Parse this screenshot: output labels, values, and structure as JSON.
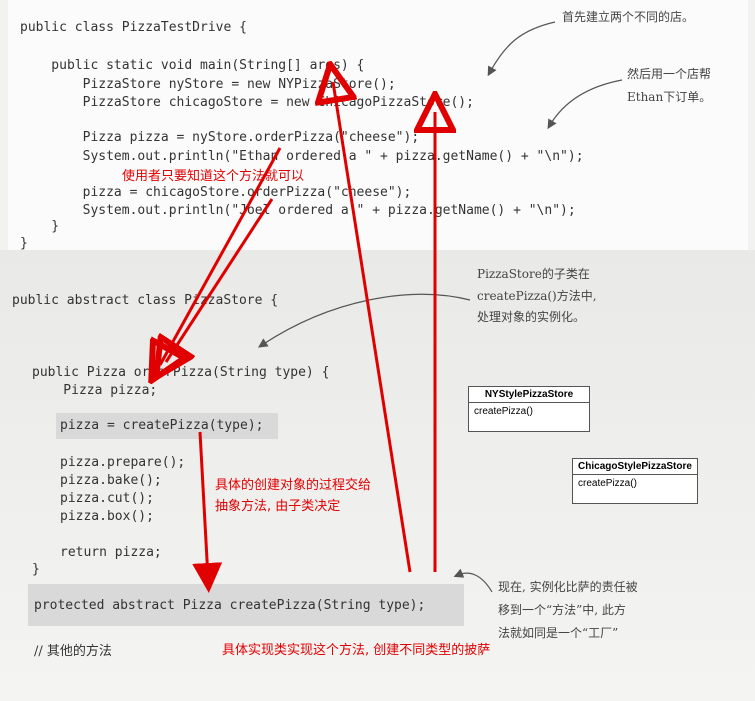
{
  "top_code": {
    "lines": [
      "public class PizzaTestDrive {",
      "    public static void main(String[] args) {",
      "        PizzaStore nyStore = new NYPizzaStore();",
      "        PizzaStore chicagoStore = new ChicagoPizzaStore();",
      "        Pizza pizza = nyStore.orderPizza(\"cheese\");",
      "        System.out.println(\"Ethan ordered a \" + pizza.getName() + \"\\n\");",
      "        pizza = chicagoStore.orderPizza(\"cheese\");",
      "        System.out.println(\"Joel ordered a \" + pizza.getName() + \"\\n\");",
      "    }",
      "}"
    ]
  },
  "bottom_code": {
    "lines": [
      "public abstract class PizzaStore {",
      "public Pizza orderPizza(String type) {",
      "    Pizza pizza;",
      "pizza = createPizza(type);",
      "pizza.prepare();",
      "pizza.bake();",
      "pizza.cut();",
      "pizza.box();",
      "return pizza;",
      "}",
      "protected abstract Pizza createPizza(String type);",
      "// 其他的方法"
    ]
  },
  "annotations": {
    "note1": "首先建立两个不同的店。",
    "note2_line1": "然后用一个店帮",
    "note2_line2": "Ethan下订单。",
    "note3_line1": "PizzaStore的子类在",
    "note3_line2": "createPizza()方法中,",
    "note3_line3": "处理对象的实例化。",
    "note4_line1": "现在, 实例化比萨的责任被",
    "note4_line2": "移到一个“方法”中, 此方",
    "note4_line3": "法就如同是一个“工厂”"
  },
  "red_notes": {
    "user_only": "使用者只要知道这个方法就可以",
    "abstract_line1": "具体的创建对象的过程交给",
    "abstract_line2": "抽象方法, 由子类决定",
    "impl": "具体实现类实现这个方法, 创建不同类型的披萨"
  },
  "uml": {
    "ny_title": "NYStylePizzaStore",
    "ny_method": "createPizza()",
    "chi_title": "ChicagoStylePizzaStore",
    "chi_method": "createPizza()"
  },
  "colors": {
    "arrow_red": "#e00000",
    "code": "#333333"
  }
}
